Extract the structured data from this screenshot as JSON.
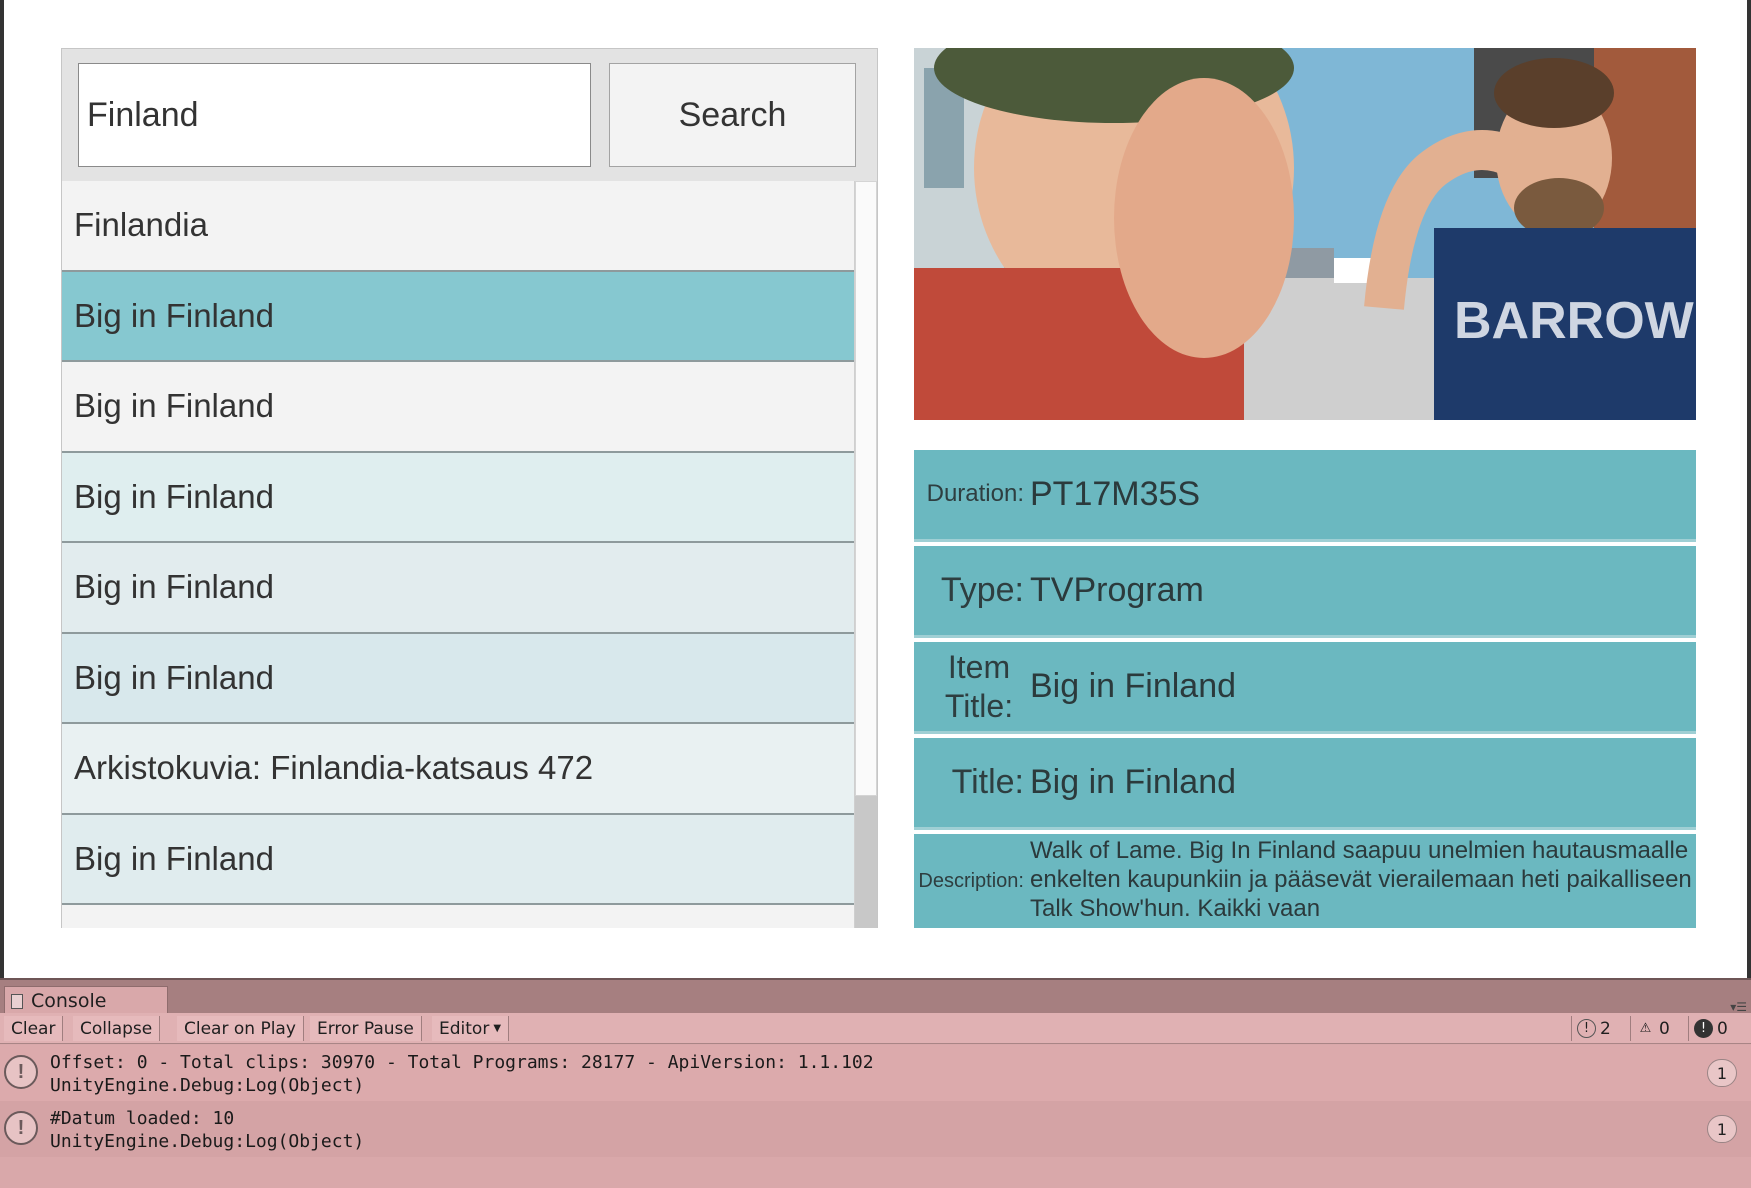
{
  "search": {
    "value": "Finland",
    "button_label": "Search"
  },
  "results": [
    {
      "label": "Finlandia",
      "bg": "#f3f3f3"
    },
    {
      "label": "Big in Finland",
      "bg": "#86c8d0"
    },
    {
      "label": "Big in Finland",
      "bg": "#f3f3f3"
    },
    {
      "label": "Big in Finland",
      "bg": "#dfeeef"
    },
    {
      "label": "Big in Finland",
      "bg": "#e2ecee"
    },
    {
      "label": "Big in Finland",
      "bg": "#d8e8ec"
    },
    {
      "label": "Arkistokuvia: Finlandia-katsaus 472",
      "bg": "#e9f1f2"
    },
    {
      "label": "Big in Finland",
      "bg": "#e0ecee"
    },
    {
      "label": "",
      "bg": "#f3f3f3"
    }
  ],
  "details": {
    "duration_label": "Duration:",
    "duration_value": "PT17M35S",
    "type_label": "Type:",
    "type_value": "TVProgram",
    "item_title_label": "Item Title:",
    "item_title_value": "Big in Finland",
    "title_label": "Title:",
    "title_value": "Big in Finland",
    "description_label": "Description:",
    "description_value": "Walk of Lame. Big In Finland saapuu unelmien hautausmaalle enkelten kaupunkiin ja pääsevät vierailemaan heti paikalliseen Talk Show'hun. Kaikki vaan"
  },
  "image": {
    "shirt_text": "BARROW"
  },
  "console": {
    "tab_label": "Console",
    "toolbar": {
      "clear": "Clear",
      "collapse": "Collapse",
      "clear_on_play": "Clear on Play",
      "error_pause": "Error Pause",
      "editor": "Editor"
    },
    "counts": {
      "logs": "2",
      "warnings": "0",
      "errors": "0"
    },
    "entries": [
      {
        "line1": "Offset: 0 - Total clips: 30970 - Total Programs: 28177 - ApiVersion: 1.1.102",
        "line2": "UnityEngine.Debug:Log(Object)",
        "count": "1"
      },
      {
        "line1": "#Datum loaded: 10",
        "line2": "UnityEngine.Debug:Log(Object)",
        "count": "1"
      }
    ]
  },
  "colors": {
    "accent": "#6bb8c0",
    "selected_row": "#86c8d0",
    "console_bg": "#d9a8aa"
  }
}
